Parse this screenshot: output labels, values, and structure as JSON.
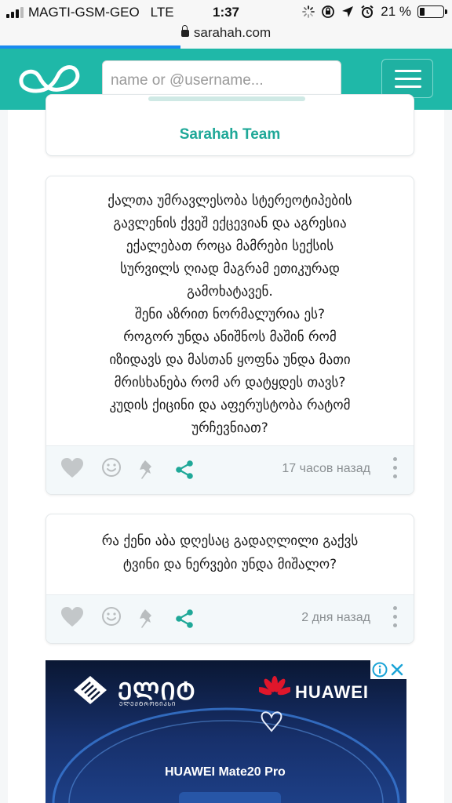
{
  "status_bar": {
    "carrier": "MAGTI-GSM-GEO",
    "network": "LTE",
    "time": "1:37",
    "battery_percent": "21 %",
    "battery_level": 0.21
  },
  "browser": {
    "url": "sarahah.com",
    "load_progress": 0.4
  },
  "header": {
    "logo_icon": "infinity-logo-icon",
    "search_placeholder": "name or @username...",
    "menu_icon": "hamburger-menu-icon",
    "accent_color": "#1fb8a8"
  },
  "team_card": {
    "label": "Sarahah Team"
  },
  "messages": [
    {
      "lines": [
        "ქალთა უმრავლესობა სტერეოტიპების",
        "გავლენის ქვეშ ექცევიან და აგრესია",
        "ექალებათ როცა მამრები სექსის",
        "სურვილს ღიად მაგრამ ეთიკურად",
        "გამოხატავენ.",
        "შენი აზრით ნორმალურია ეს?",
        "როგორ უნდა ანიშნოს მაშინ რომ",
        "იზიდავს და მასთან ყოფნა უნდა  მათი",
        "მრისხანება რომ არ დატყდეს თავს?",
        "კუდის ქიცინი და აფერუსტობა რატომ",
        "ურჩევნიათ?"
      ],
      "time": "17 часов назад"
    },
    {
      "lines": [
        "რა ქენი აბა დღესაც გადაღლილი გაქვს",
        "ტვინი და ნერვები უნდა მიშალო?"
      ],
      "time": "2 дня назад"
    }
  ],
  "ad": {
    "brand_left": "ᲔᲚᲘᲢ",
    "brand_left_sub": "ᲔᲚᲔᲥᲢᲠᲝᲜᲘᲙᲡᲘ",
    "brand_right": "HUAWEI",
    "product": "HUAWEI Mate20 Pro"
  }
}
